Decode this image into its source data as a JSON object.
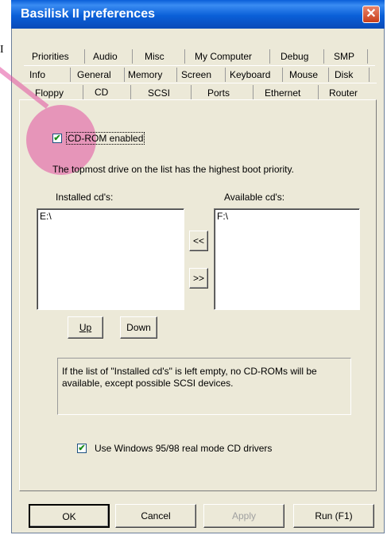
{
  "window": {
    "title": "Basilisk II preferences",
    "close_glyph": "✕",
    "partial_left_glyph": "I"
  },
  "tabs": {
    "row1": [
      "Priorities",
      "Audio",
      "Misc",
      "My Computer",
      "Debug",
      "SMP"
    ],
    "row2": [
      "Info",
      "General",
      "Memory",
      "Screen",
      "Keyboard",
      "Mouse",
      "Disk"
    ],
    "row3": [
      "Floppy",
      "CD",
      "SCSI",
      "Ports",
      "Ethernet",
      "Router"
    ],
    "active": "CD"
  },
  "cd_page": {
    "enabled_checkbox": {
      "label": "CD-ROM enabled",
      "checked": true
    },
    "priority_note": "The topmost drive on the list has the highest boot priority.",
    "installed": {
      "label": "Installed cd's:",
      "items": [
        "E:\\"
      ]
    },
    "available": {
      "label": "Available cd's:",
      "items": [
        "F:\\"
      ]
    },
    "move_left_label": "<<",
    "move_right_label": ">>",
    "up_button": "Up",
    "down_button": "Down",
    "info_text": "If the list of \"Installed cd's\" is left empty, no CD-ROMs will be available, except possible SCSI devices.",
    "real_mode_checkbox": {
      "label": "Use Windows 95/98 real mode CD drivers",
      "checked": true
    }
  },
  "footer": {
    "ok_label": "OK",
    "cancel_label": "Cancel",
    "apply_label": "Apply",
    "run_label": "Run (F1)"
  },
  "icons": {
    "check": "checkmark-icon",
    "close": "close-icon"
  },
  "colors": {
    "titlebar": "#0a5fd8",
    "dialog_bg": "#ece9d8",
    "highlight": "#e250a0",
    "close_button": "#c83e1a"
  }
}
